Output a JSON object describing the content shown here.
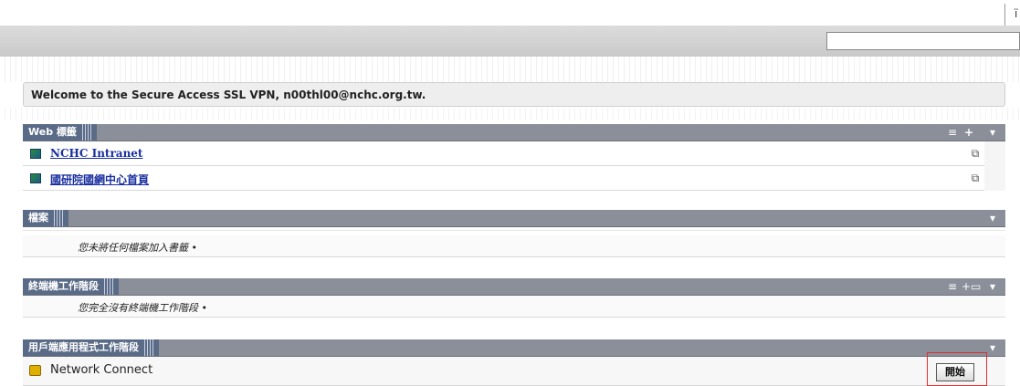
{
  "topbar": {
    "corner_text": "ï"
  },
  "header": {
    "search_value": ""
  },
  "welcome": {
    "text": "Welcome to the Secure Access SSL VPN, n00thl00@nchc.org.tw."
  },
  "panels": {
    "web": {
      "title": "Web 標籤",
      "controls": {
        "list": "≡",
        "add": "+",
        "menu": "▾"
      },
      "items": [
        {
          "label": "NCHC Intranet "
        },
        {
          "label": "國研院國網中心首頁 "
        }
      ],
      "newwin_glyph": "⧉"
    },
    "files": {
      "title": "檔案",
      "menu": "▾",
      "empty_text": "您未將任何檔案加入書籤 •"
    },
    "terminal": {
      "title": "終端機工作階段",
      "controls": {
        "list": "≡",
        "add": "+▭",
        "menu": "▾"
      },
      "empty_text": "您完全沒有終端機工作階段 •"
    },
    "client": {
      "title": "用戶端應用程式工作階段",
      "menu": "▾",
      "item_label": "Network Connect",
      "start_label": "開始"
    }
  },
  "colors": {
    "panel_head": "#8a8f99",
    "panel_tab": "#5a6b87",
    "link": "#1a2fa0",
    "highlight": "#e03030"
  }
}
